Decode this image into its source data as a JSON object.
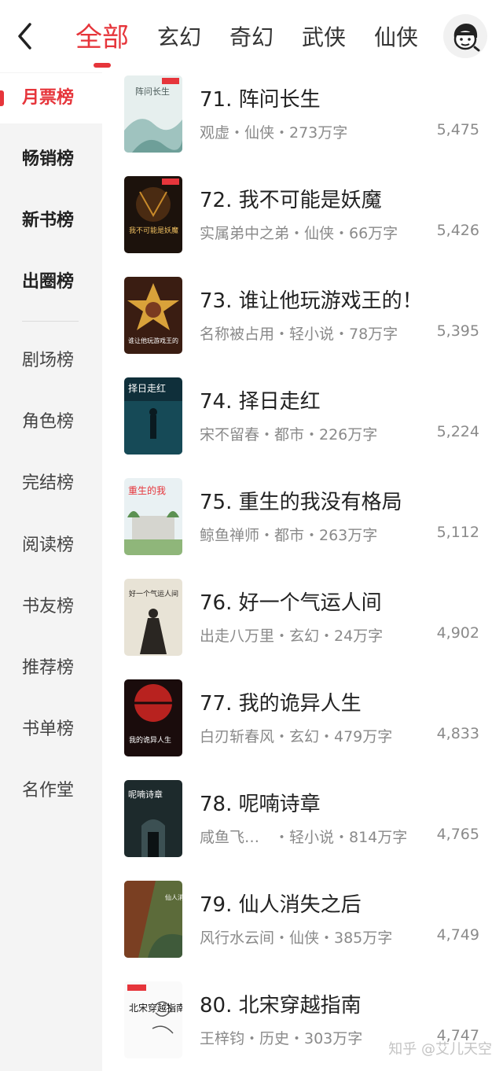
{
  "header": {
    "tabs": [
      {
        "label": "全部",
        "active": true
      },
      {
        "label": "玄幻"
      },
      {
        "label": "奇幻"
      },
      {
        "label": "武侠"
      },
      {
        "label": "仙侠"
      }
    ],
    "back_icon": "chevron-left-icon",
    "avatar_icon": "cartoon-avatar-icon",
    "accent_color": "#e6353b"
  },
  "sidebar": {
    "items": [
      {
        "label": "月票榜",
        "active": true
      },
      {
        "label": "畅销榜",
        "strong": true
      },
      {
        "label": "新书榜",
        "strong": true
      },
      {
        "label": "出圈榜",
        "strong": true
      },
      {
        "label": "剧场榜"
      },
      {
        "label": "角色榜"
      },
      {
        "label": "完结榜"
      },
      {
        "label": "阅读榜"
      },
      {
        "label": "书友榜"
      },
      {
        "label": "推荐榜"
      },
      {
        "label": "书单榜"
      },
      {
        "label": "名作堂"
      }
    ]
  },
  "books": [
    {
      "title": "71. 阵问长生",
      "meta": "观虚・仙侠・273万字",
      "votes": "5,475",
      "cover_text": "阵问长生"
    },
    {
      "title": "72. 我不可能是妖魔",
      "meta": "实属弟中之弟・仙侠・66万字",
      "votes": "5,426",
      "cover_text": "我不可能是妖魔"
    },
    {
      "title": "73. 谁让他玩游戏王的！",
      "meta": "名称被占用・轻小说・78万字",
      "votes": "5,395",
      "cover_text": "谁让他玩游戏王的"
    },
    {
      "title": "74. 择日走红",
      "meta": "宋不留春・都市・226万字",
      "votes": "5,224",
      "cover_text": "择日走红"
    },
    {
      "title": "75. 重生的我没有格局",
      "meta": "鲸鱼禅师・都市・263万字",
      "votes": "5,112",
      "cover_text": "重生的我"
    },
    {
      "title": "76. 好一个气运人间",
      "meta": "出走八万里・玄幻・24万字",
      "votes": "4,902",
      "cover_text": "好一个气运人间"
    },
    {
      "title": "77. 我的诡异人生",
      "meta": "白刃斩春风・玄幻・479万字",
      "votes": "4,833",
      "cover_text": "我的诡异人生"
    },
    {
      "title": "78. 呢喃诗章",
      "meta": "咸鱼飞…　・轻小说・814万字",
      "votes": "4,765",
      "cover_text": "呢喃诗章"
    },
    {
      "title": "79. 仙人消失之后",
      "meta": "风行水云间・仙侠・385万字",
      "votes": "4,749",
      "cover_text": "仙人消失之后"
    },
    {
      "title": "80. 北宋穿越指南",
      "meta": "王梓钧・历史・303万字",
      "votes": "4,747",
      "cover_text": "北宋穿越指南"
    }
  ],
  "watermark": "知乎 @艾儿天空"
}
